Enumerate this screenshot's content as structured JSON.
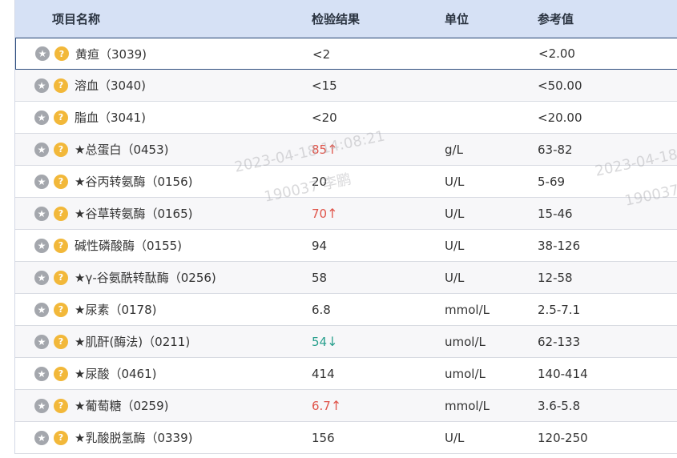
{
  "columns": {
    "name": "项目名称",
    "result": "检验结果",
    "unit": "单位",
    "ref": "参考值"
  },
  "rows": [
    {
      "name": "黄疸（3039)",
      "result": "<2",
      "arrow": "",
      "status": "normal",
      "unit": "",
      "ref": "<2.00"
    },
    {
      "name": "溶血（3040)",
      "result": "<15",
      "arrow": "",
      "status": "normal",
      "unit": "",
      "ref": "<50.00"
    },
    {
      "name": "脂血（3041)",
      "result": "<20",
      "arrow": "",
      "status": "normal",
      "unit": "",
      "ref": "<20.00"
    },
    {
      "name": "★总蛋白（0453)",
      "result": "85",
      "arrow": "↑",
      "status": "high",
      "unit": "g/L",
      "ref": "63-82"
    },
    {
      "name": "★谷丙转氨酶（0156)",
      "result": "20",
      "arrow": "",
      "status": "normal",
      "unit": "U/L",
      "ref": "5-69"
    },
    {
      "name": "★谷草转氨酶（0165)",
      "result": "70",
      "arrow": "↑",
      "status": "high",
      "unit": "U/L",
      "ref": "15-46"
    },
    {
      "name": "碱性磷酸酶（0155)",
      "result": "94",
      "arrow": "",
      "status": "normal",
      "unit": "U/L",
      "ref": "38-126"
    },
    {
      "name": "★γ-谷氨酰转酞酶（0256)",
      "result": "58",
      "arrow": "",
      "status": "normal",
      "unit": "U/L",
      "ref": "12-58"
    },
    {
      "name": "★尿素（0178)",
      "result": "6.8",
      "arrow": "",
      "status": "normal",
      "unit": "mmol/L",
      "ref": "2.5-7.1"
    },
    {
      "name": "★肌酐(酶法)（0211)",
      "result": "54",
      "arrow": "↓",
      "status": "low",
      "unit": "umol/L",
      "ref": "62-133"
    },
    {
      "name": "★尿酸（0461)",
      "result": "414",
      "arrow": "",
      "status": "normal",
      "unit": "umol/L",
      "ref": "140-414"
    },
    {
      "name": "★葡萄糖（0259)",
      "result": "6.7",
      "arrow": "↑",
      "status": "high",
      "unit": "mmol/L",
      "ref": "3.6-5.8"
    },
    {
      "name": "★乳酸脱氢酶（0339)",
      "result": "156",
      "arrow": "",
      "status": "normal",
      "unit": "U/L",
      "ref": "120-250"
    }
  ],
  "selected_row": 0,
  "icons": {
    "row_left": "star-icon",
    "row_right": "help-icon"
  },
  "colors": {
    "high": "#e0554b",
    "low": "#2aa08e",
    "header_bg": "#d6e1f5"
  },
  "watermarks": [
    {
      "line1": "2023-04-18 14:08:21",
      "line2": "190037 李鹏"
    },
    {
      "line1": "2023-04-18",
      "line2": "190037"
    }
  ]
}
